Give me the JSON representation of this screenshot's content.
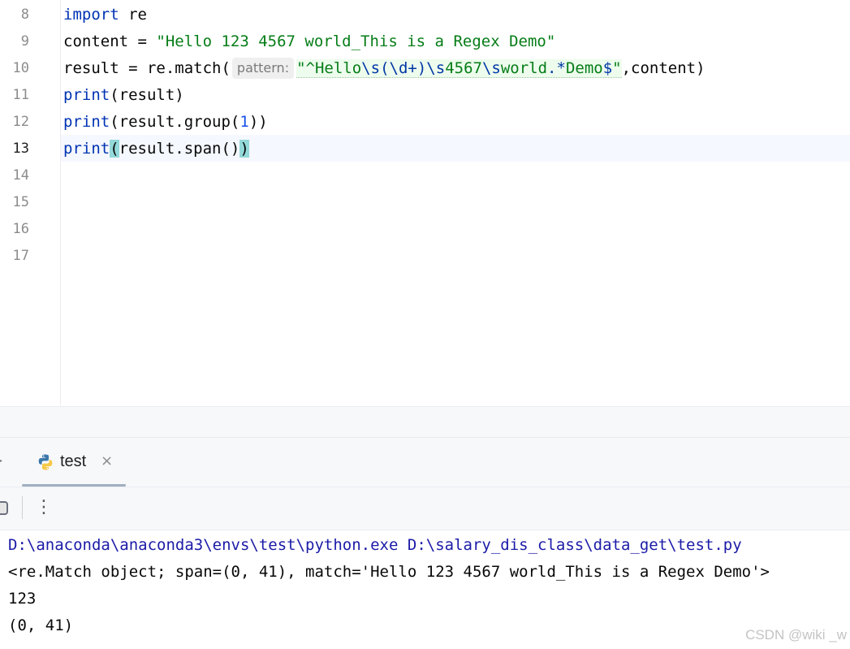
{
  "editor": {
    "line_numbers": [
      "8",
      "9",
      "10",
      "11",
      "12",
      "13",
      "14",
      "15",
      "16",
      "17"
    ],
    "current_line": "13",
    "code": {
      "l8": {
        "kw": "import",
        "rest": " re"
      },
      "l9": {
        "name": "content = ",
        "str": "\"Hello 123 4567 world_This is a Regex Demo\""
      },
      "l10": {
        "prefix": "result = re.match(",
        "hint": "pattern:",
        "rx": [
          {
            "t": "\"^Hello",
            "c": "str"
          },
          {
            "t": "\\s",
            "c": "esc"
          },
          {
            "t": "(",
            "c": "esc"
          },
          {
            "t": "\\d+",
            "c": "esc"
          },
          {
            "t": ")",
            "c": "esc"
          },
          {
            "t": "\\s",
            "c": "esc"
          },
          {
            "t": "4567",
            "c": "str"
          },
          {
            "t": "\\s",
            "c": "esc"
          },
          {
            "t": "world",
            "c": "str"
          },
          {
            "t": ".*",
            "c": "esc"
          },
          {
            "t": "Demo",
            "c": "str"
          },
          {
            "t": "$",
            "c": "esc"
          },
          {
            "t": "\"",
            "c": "str"
          }
        ],
        "suffix": ",content)"
      },
      "l11": {
        "kw": "print",
        "rest": "(result)"
      },
      "l12": {
        "kw": "print",
        "a": "(result.group(",
        "num": "1",
        "b": "))"
      },
      "l13": {
        "kw": "print",
        "open": "(",
        "mid": "result.span()",
        "close": ")"
      }
    }
  },
  "run_panel": {
    "tab_label": "test",
    "close_glyph": "×",
    "menu_glyph": "⋮",
    "console_lines": [
      "D:\\anaconda\\anaconda3\\envs\\test\\python.exe D:\\salary_dis_class\\data_get\\test.py",
      "<re.Match object; span=(0, 41), match='Hello 123 4567 world_This is a Regex Demo'>",
      "123",
      "(0, 41)"
    ]
  },
  "watermark": "CSDN @wiki _w",
  "colors": {
    "keyword": "#0033b3",
    "string": "#067d17",
    "number": "#1750eb",
    "brace_highlight": "#93d9d9",
    "command_line": "#1b1ba8"
  }
}
